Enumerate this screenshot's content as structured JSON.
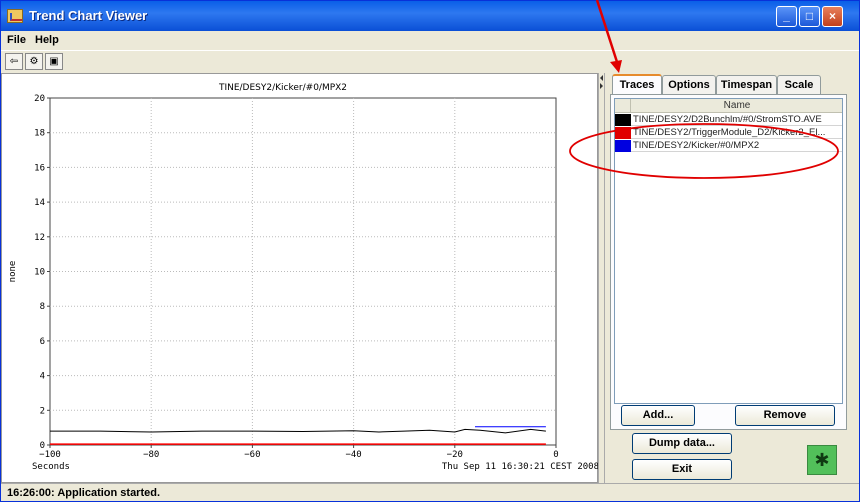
{
  "window": {
    "title": "Trend Chart Viewer",
    "min_label": "_",
    "max_label": "□",
    "close_label": "×"
  },
  "menu": [
    "File",
    "Help"
  ],
  "toolbar": [
    "⇦",
    "⚙",
    "▣"
  ],
  "chart_data": {
    "type": "line",
    "title": "TINE/DESY2/Kicker/#0/MPX2",
    "xlabel": "Seconds",
    "ylabel": "none",
    "timestamp": "Thu Sep 11 16:30:21 CEST 2008",
    "xlim": [
      -100,
      0
    ],
    "ylim": [
      0,
      20
    ],
    "x_ticks": [
      "−100",
      "−80",
      "−60",
      "−40",
      "−20",
      "0"
    ],
    "y_ticks": [
      "0",
      "2",
      "4",
      "6",
      "8",
      "10",
      "12",
      "14",
      "16",
      "18",
      "20"
    ],
    "x_tick_values": [
      -100,
      -80,
      -60,
      -40,
      -20,
      0
    ],
    "y_tick_values": [
      0,
      2,
      4,
      6,
      8,
      10,
      12,
      14,
      16,
      18,
      20
    ],
    "grid": true,
    "series": [
      {
        "color": "#000000",
        "x": [
          -100,
          -90,
          -80,
          -70,
          -60,
          -50,
          -40,
          -35,
          -30,
          -25,
          -20,
          -18,
          -15,
          -10,
          -5,
          -2
        ],
        "values": [
          0.8,
          0.8,
          0.75,
          0.8,
          0.8,
          0.78,
          0.82,
          0.75,
          0.8,
          0.85,
          0.75,
          0.9,
          0.85,
          0.7,
          0.9,
          0.8
        ]
      },
      {
        "color": "#ff0000",
        "x": [
          -100,
          -2
        ],
        "values": [
          0.05,
          0.05
        ]
      },
      {
        "color": "#0000ff",
        "x": [
          -16,
          -2
        ],
        "values": [
          1.05,
          1.05
        ]
      }
    ]
  },
  "tabs": [
    "Traces",
    "Options",
    "Timespan",
    "Scale"
  ],
  "traces": {
    "header": "Name",
    "rows": [
      {
        "color": "#000000",
        "name": "TINE/DESY2/D2Bunchlm/#0/StromSTO.AVE"
      },
      {
        "color": "#e00000",
        "name": "TINE/DESY2/TriggerModule_D2/Kicker2_El..."
      },
      {
        "color": "#0000e0",
        "name": "TINE/DESY2/Kicker/#0/MPX2"
      }
    ]
  },
  "buttons": {
    "add": "Add...",
    "remove": "Remove",
    "dump": "Dump data...",
    "exit": "Exit"
  },
  "status": "16:26:00: Application started."
}
